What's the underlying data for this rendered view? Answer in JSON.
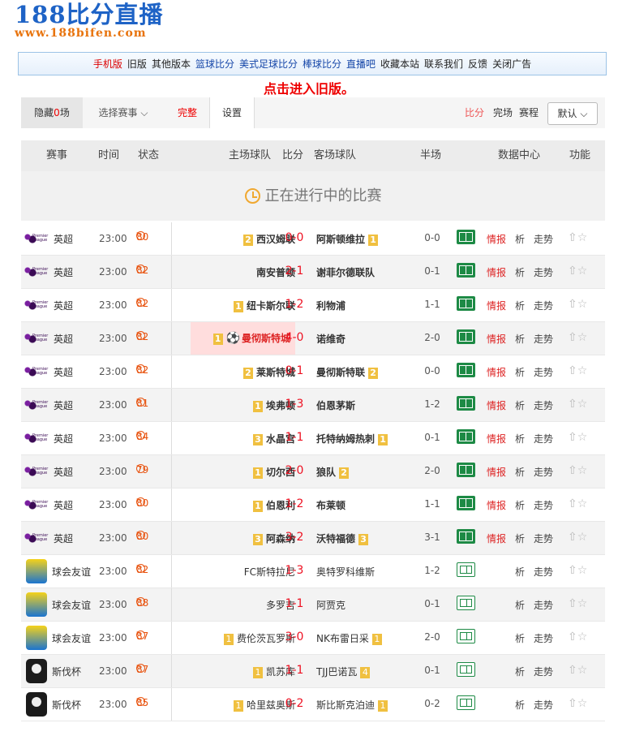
{
  "logo": {
    "title": "188比分直播",
    "url": "www.188bifen.com"
  },
  "topnav": [
    {
      "label": "手机版",
      "color": "red"
    },
    {
      "label": "旧版",
      "color": "dark"
    },
    {
      "label": "其他版本",
      "color": "dark"
    },
    {
      "label": "篮球比分",
      "color": "blue"
    },
    {
      "label": "美式足球比分",
      "color": "blue"
    },
    {
      "label": "棒球比分",
      "color": "blue"
    },
    {
      "label": "直播吧",
      "color": "blue"
    },
    {
      "label": "收藏本站",
      "color": "dark"
    },
    {
      "label": "联系我们",
      "color": "dark"
    },
    {
      "label": "反馈",
      "color": "dark"
    },
    {
      "label": "关闭广告",
      "color": "dark"
    }
  ],
  "old_version_link": "点击进入旧版。",
  "toolbar": {
    "hide_prefix": "隐藏",
    "hide_count": "0",
    "hide_suffix": "场",
    "select": "选择赛事",
    "select_arrow": "⌵",
    "full": "完整",
    "settings": "设置",
    "score": "比分",
    "finished": "完场",
    "schedule": "赛程",
    "default": "默认",
    "default_arrow": "⌵"
  },
  "header": {
    "league": "赛事",
    "time": "时间",
    "status": "状态",
    "home": "主场球队",
    "score": "比分",
    "away": "客场球队",
    "half": "半场",
    "data": "数据中心",
    "func": "功能"
  },
  "live_title": "正在进行中的比赛",
  "colors": {
    "accent": "#e8530f",
    "score_red": "#e12",
    "field_green": "#1d8a45",
    "rank_yellow": "#f0c040"
  },
  "matches": [
    {
      "league": "英超",
      "icon": "pl",
      "time": "23:00",
      "min": "80",
      "home": "西汉姆联",
      "hr": "2",
      "score": "0-0",
      "away": "阿斯顿维拉",
      "ar": "1",
      "half": "0-0",
      "intel": "情报",
      "ana": "析",
      "trend": "走势",
      "alt": false,
      "bold": true,
      "field": "full"
    },
    {
      "league": "英超",
      "icon": "pl",
      "time": "23:00",
      "min": "82",
      "home": "南安普顿",
      "hr": "",
      "score": "2-1",
      "away": "谢菲尔德联队",
      "ar": "",
      "half": "0-1",
      "intel": "情报",
      "ana": "析",
      "trend": "走势",
      "alt": true,
      "bold": true,
      "field": "full"
    },
    {
      "league": "英超",
      "icon": "pl",
      "time": "23:00",
      "min": "82",
      "home": "纽卡斯尔联",
      "hr": "1",
      "score": "1-2",
      "away": "利物浦",
      "ar": "",
      "half": "1-1",
      "intel": "情报",
      "ana": "析",
      "trend": "走势",
      "alt": false,
      "bold": true,
      "field": "full"
    },
    {
      "league": "英超",
      "icon": "pl",
      "time": "23:00",
      "min": "82",
      "home": "曼彻斯特城",
      "hr": "1",
      "score": "4-0",
      "away": "诺维奇",
      "ar": "",
      "half": "2-0",
      "intel": "情报",
      "ana": "析",
      "trend": "走势",
      "alt": true,
      "bold": true,
      "hl": true,
      "field": "full"
    },
    {
      "league": "英超",
      "icon": "pl",
      "time": "23:00",
      "min": "82",
      "home": "莱斯特城",
      "hr": "2",
      "score": "0-1",
      "away": "曼彻斯特联",
      "ar": "2",
      "half": "0-0",
      "intel": "情报",
      "ana": "析",
      "trend": "走势",
      "alt": false,
      "bold": true,
      "field": "full"
    },
    {
      "league": "英超",
      "icon": "pl",
      "time": "23:00",
      "min": "81",
      "home": "埃弗顿",
      "hr": "1",
      "score": "1-3",
      "away": "伯恩茅斯",
      "ar": "",
      "half": "1-2",
      "intel": "情报",
      "ana": "析",
      "trend": "走势",
      "alt": true,
      "bold": true,
      "field": "full"
    },
    {
      "league": "英超",
      "icon": "pl",
      "time": "23:00",
      "min": "84",
      "home": "水晶宫",
      "hr": "3",
      "score": "1-1",
      "away": "托特纳姆热刺",
      "ar": "1",
      "half": "0-1",
      "intel": "情报",
      "ana": "析",
      "trend": "走势",
      "alt": false,
      "bold": true,
      "field": "full"
    },
    {
      "league": "英超",
      "icon": "pl",
      "time": "23:00",
      "min": "79",
      "home": "切尔西",
      "hr": "1",
      "score": "2-0",
      "away": "狼队",
      "ar": "2",
      "half": "2-0",
      "intel": "情报",
      "ana": "析",
      "trend": "走势",
      "alt": true,
      "bold": true,
      "field": "full"
    },
    {
      "league": "英超",
      "icon": "pl",
      "time": "23:00",
      "min": "80",
      "home": "伯恩利",
      "hr": "1",
      "score": "1-2",
      "away": "布莱顿",
      "ar": "",
      "half": "1-1",
      "intel": "情报",
      "ana": "析",
      "trend": "走势",
      "alt": false,
      "bold": true,
      "field": "full"
    },
    {
      "league": "英超",
      "icon": "pl",
      "time": "23:00",
      "min": "80",
      "home": "阿森纳",
      "hr": "3",
      "score": "3-2",
      "away": "沃特福德",
      "ar": "3",
      "half": "3-1",
      "intel": "情报",
      "ana": "析",
      "trend": "走势",
      "alt": true,
      "bold": true,
      "field": "full"
    },
    {
      "league": "球会友谊",
      "icon": "cf",
      "time": "23:00",
      "min": "82",
      "home": "FC斯特拉尼",
      "hr": "",
      "score": "1-3",
      "away": "奥特罗科维斯",
      "ar": "",
      "half": "1-2",
      "intel": "",
      "ana": "析",
      "trend": "走势",
      "alt": false,
      "bold": false,
      "field": "empty"
    },
    {
      "league": "球会友谊",
      "icon": "cf",
      "time": "23:00",
      "min": "88",
      "home": "多罗吉",
      "hr": "",
      "score": "1-1",
      "away": "阿贾克",
      "ar": "",
      "half": "0-1",
      "intel": "",
      "ana": "析",
      "trend": "走势",
      "alt": true,
      "bold": false,
      "field": "empty"
    },
    {
      "league": "球会友谊",
      "icon": "cf",
      "time": "23:00",
      "min": "87",
      "home": "费伦茨瓦罗斯",
      "hr": "1",
      "score": "3-0",
      "away": "NK布雷日采",
      "ar": "1",
      "half": "2-0",
      "intel": "",
      "ana": "析",
      "trend": "走势",
      "alt": false,
      "bold": false,
      "field": "empty"
    },
    {
      "league": "斯伐杯",
      "icon": "sc",
      "time": "23:00",
      "min": "87",
      "home": "凯苏库",
      "hr": "1",
      "score": "1-1",
      "away": "TJJ巴诺瓦",
      "ar": "4",
      "half": "0-1",
      "intel": "",
      "ana": "析",
      "trend": "走势",
      "alt": true,
      "bold": false,
      "field": "empty"
    },
    {
      "league": "斯伐杯",
      "icon": "sc",
      "time": "23:00",
      "min": "85",
      "home": "哈里兹奥斯",
      "hr": "1",
      "score": "0-2",
      "away": "斯比斯克泊迪",
      "ar": "1",
      "half": "0-2",
      "intel": "",
      "ana": "析",
      "trend": "走势",
      "alt": false,
      "bold": false,
      "field": "empty"
    }
  ]
}
